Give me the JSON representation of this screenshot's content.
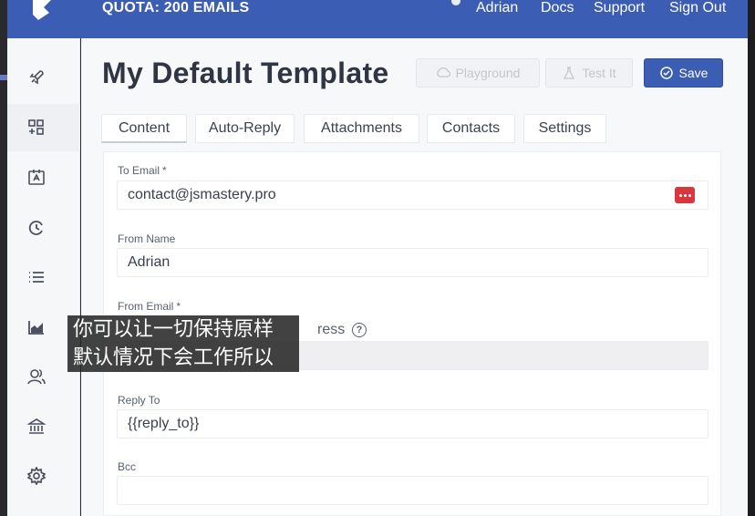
{
  "header": {
    "quota": "QUOTA: 200 EMAILS",
    "nav": [
      "Adrian",
      "Docs",
      "Support",
      "Sign Out"
    ]
  },
  "sidebar": {
    "icons": [
      "rocket-icon",
      "templates-icon",
      "contacts-card-icon",
      "history-icon",
      "list-icon",
      "analytics-icon",
      "users-icon",
      "bank-icon",
      "settings-gear-icon"
    ]
  },
  "page": {
    "title": "My Default Template",
    "buttons": {
      "playground": "Playground",
      "test": "Test It",
      "save": "Save"
    },
    "tabs": [
      "Content",
      "Auto-Reply",
      "Attachments",
      "Contacts",
      "Settings"
    ]
  },
  "form": {
    "to_email_label": "To Email",
    "to_email_value": "contact@jsmastery.pro",
    "from_name_label": "From Name",
    "from_name_value": "Adrian",
    "from_email_label": "From Email",
    "from_email_checkbox_partial": "ress",
    "from_email_value": "",
    "reply_to_label": "Reply To",
    "reply_to_value": "{{reply_to}}",
    "bcc_label": "Bcc",
    "bcc_value": "",
    "required_mark": "*"
  },
  "subtitle": {
    "line1": "你可以让一切保持原样",
    "line2": "默认情况下会工作所以"
  },
  "colors": {
    "brand": "#3b5db3",
    "danger": "#d9363e"
  }
}
